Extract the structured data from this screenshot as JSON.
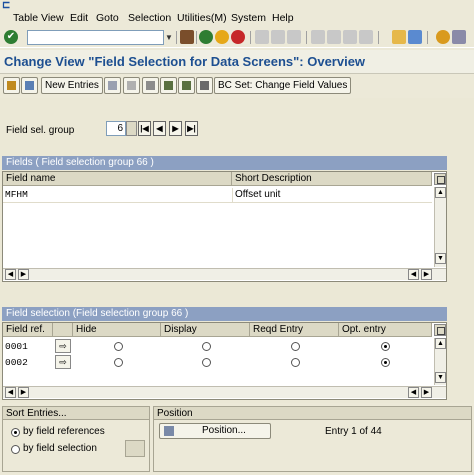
{
  "menu": {
    "items": [
      "Table View",
      "Edit",
      "Goto",
      "Selection",
      "Utilities(M)",
      "System",
      "Help"
    ]
  },
  "title": "Change View \"Field Selection for Data Screens\": Overview",
  "app_toolbar": {
    "new_entries": "New Entries",
    "bc_set": "BC Set: Change Field Values"
  },
  "field_group": {
    "label": "Field sel. group",
    "value": "6"
  },
  "fields_table": {
    "caption": "Fields  ( Field selection group  66 )",
    "columns": [
      "Field name",
      "Short Description"
    ],
    "rows": [
      {
        "field_name": "MFHM",
        "short_desc": "Offset unit"
      }
    ]
  },
  "selection_table": {
    "caption": "Field selection (Field selection group  66 )",
    "columns": [
      "Field ref.",
      "",
      "Hide",
      "Display",
      "Reqd Entry",
      "Opt. entry"
    ],
    "rows": [
      {
        "ref": "0001",
        "selected": "opt"
      },
      {
        "ref": "0002",
        "selected": "opt"
      }
    ]
  },
  "sort": {
    "title": "Sort Entries...",
    "opt1": "by field references",
    "opt2": "by field selection"
  },
  "position": {
    "title": "Position",
    "button": "Position...",
    "entry_text": "Entry 1 of 44"
  }
}
